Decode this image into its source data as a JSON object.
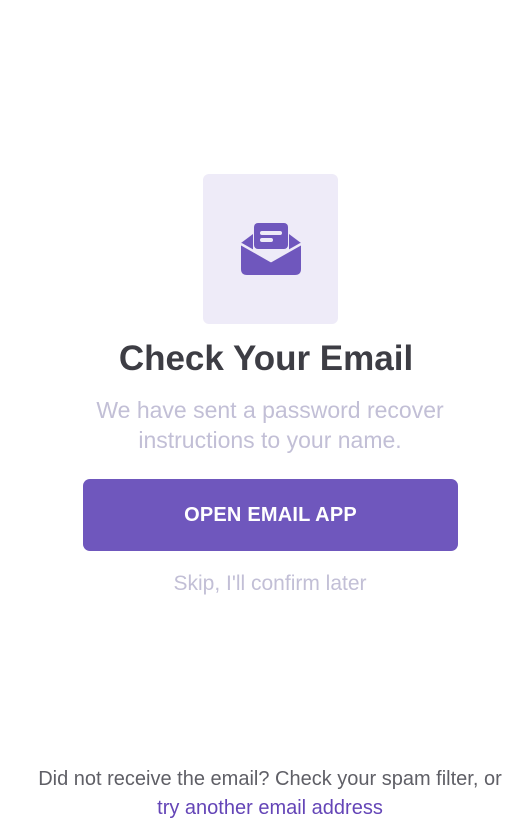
{
  "screen": {
    "icon": "open-envelope-icon",
    "title": "Check Your Email",
    "subtitle": "We have sent a password recover instructions to your name."
  },
  "actions": {
    "open_email_app_label": "OPEN EMAIL APP",
    "skip_label": "Skip, I'll confirm later"
  },
  "footer": {
    "prompt_text": "Did not receive the email? Check your spam filter, or",
    "link_text": "try another email address"
  },
  "colors": {
    "accent": "#6f57bd",
    "icon_tile_bg": "#eeebf8",
    "title": "#3d3d44",
    "muted": "#c2bfd6",
    "link": "#6445b7"
  }
}
